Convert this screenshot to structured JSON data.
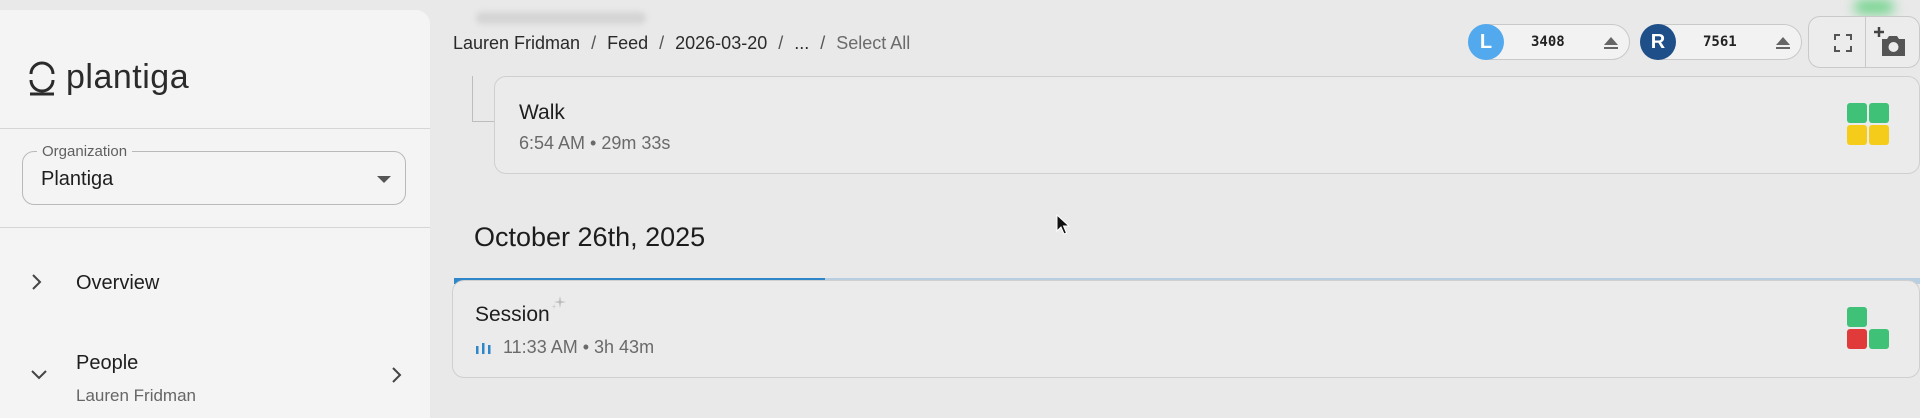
{
  "app": {
    "brand": "plantiga"
  },
  "sidebar": {
    "organization": {
      "label": "Organization",
      "value": "Plantiga"
    },
    "items": [
      {
        "label": "Overview",
        "expanded": false
      },
      {
        "label": "People",
        "sub_label": "Lauren Fridman",
        "expanded": true
      }
    ]
  },
  "breadcrumb": [
    "Lauren Fridman",
    "Feed",
    "2026-03-20",
    "...",
    "Select All"
  ],
  "breadcrumb_separator": "/",
  "sensors": [
    {
      "side": "L",
      "value": "3408",
      "color": "#52a9ee"
    },
    {
      "side": "R",
      "value": "7561",
      "color": "#1e4f88"
    }
  ],
  "toolbar": {
    "fullscreen_icon": "fullscreen-icon",
    "screenshot_icon": "camera-plus-icon"
  },
  "feed": {
    "walk": {
      "title": "Walk",
      "meta": "6:54 AM • 29m 33s",
      "grid": [
        "#3fc178",
        "#3fc178",
        "#f5cc1a",
        "#f5cc1a"
      ]
    },
    "date_heading": "October 26th, 2025",
    "session": {
      "title": "Session",
      "meta": "11:33 AM • 3h 43m",
      "progress": 0.253,
      "grid": [
        "#3fc178",
        "transparent",
        "#e03a3a",
        "#3fc178"
      ]
    }
  },
  "colors": {
    "progress": "#2f86c9",
    "track": "#b8cfe2"
  }
}
